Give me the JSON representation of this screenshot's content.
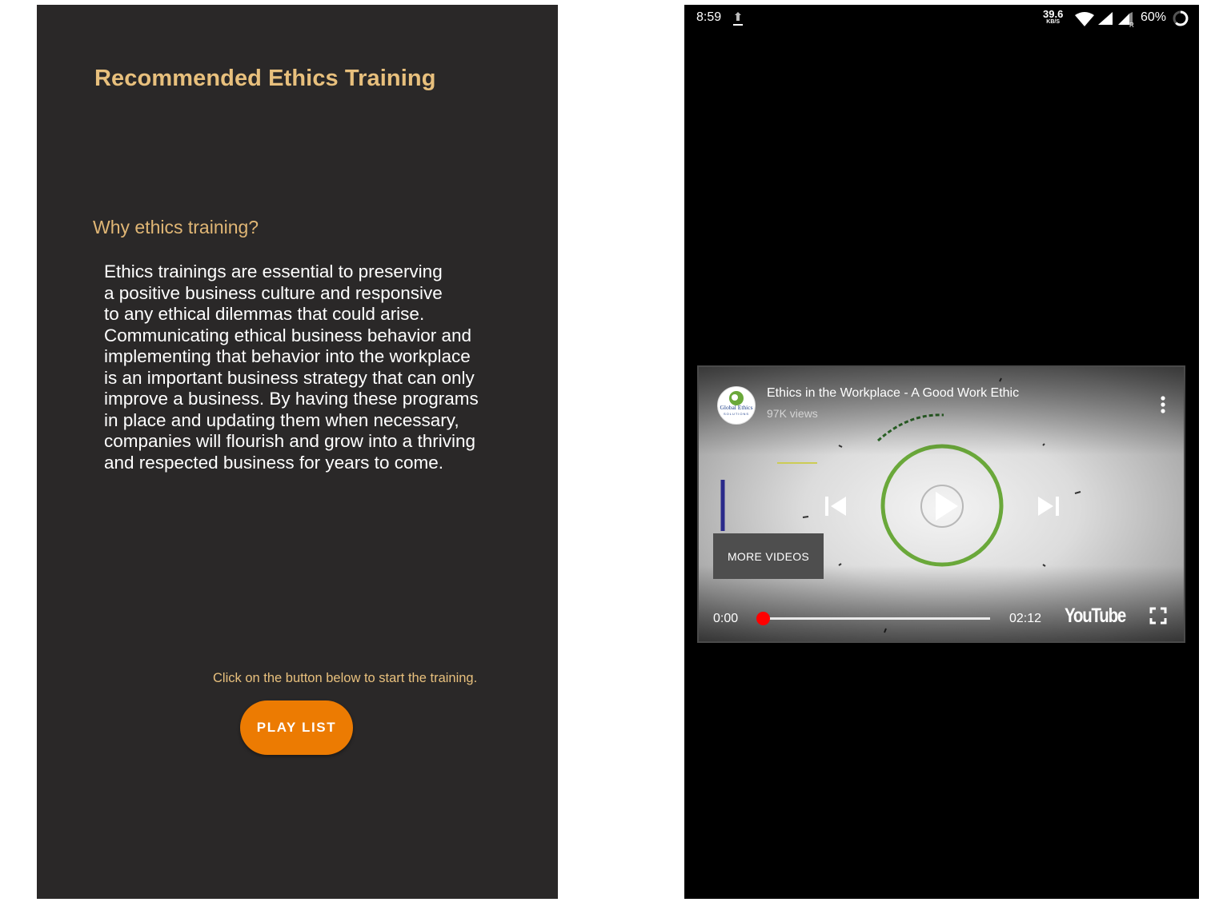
{
  "left_screen": {
    "title": "Recommended Ethics Training",
    "section_heading": "Why ethics training?",
    "body_lines": [
      "Ethics trainings are essential to preserving",
      "a positive business culture and responsive",
      "to any ethical dilemmas that could arise.",
      "Communicating ethical business behavior and",
      "implementing that behavior into the workplace",
      "is an important business strategy that can only",
      "improve a business. By having these programs",
      "in place and updating them when necessary,",
      "companies will flourish and grow into a thriving",
      "and respected business for years to come."
    ],
    "hint": "Click on the button below to start the training.",
    "play_button_label": "PLAY LIST"
  },
  "status_bar": {
    "time": "8:59",
    "net_speed_value": "39.6",
    "net_speed_unit": "KB/S",
    "battery_percent": "60%",
    "icons": [
      "upload-icon",
      "wifi-icon",
      "signal-icon",
      "signal-roaming-icon",
      "battery-icon"
    ]
  },
  "video_player": {
    "channel_logo_text": "Global Ethics",
    "channel_logo_subtext": "SOLUTIONS",
    "title": "Ethics in the Workplace - A Good Work Ethic",
    "views": "97K views",
    "more_videos_label": "MORE VIDEOS",
    "current_time": "0:00",
    "total_time": "02:12",
    "progress_fraction": 0.0,
    "brand": "YouTube",
    "colors": {
      "progress": "#ff0000",
      "accent_ring": "#6aa83a",
      "button_orange": "#ec7b02",
      "title_gold": "#e8c07d"
    },
    "icons": [
      "more-options-icon",
      "previous-icon",
      "play-icon",
      "next-icon",
      "fullscreen-icon"
    ]
  }
}
